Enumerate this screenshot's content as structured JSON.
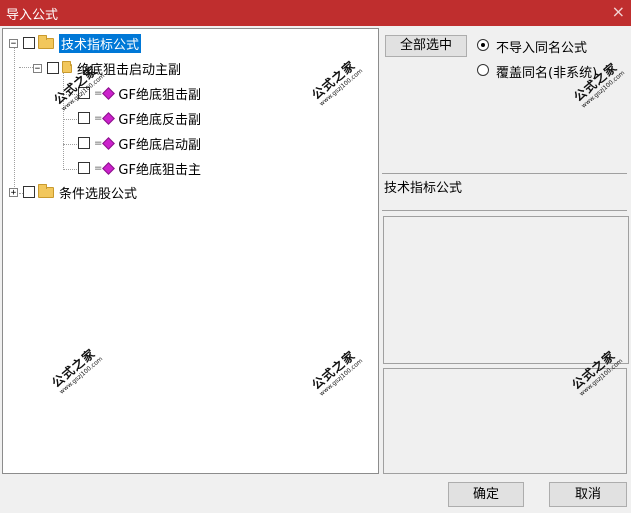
{
  "window": {
    "title": "导入公式",
    "close_icon": "×"
  },
  "tree": {
    "root1": {
      "label": "技术指标公式",
      "expanded": true,
      "selected": true
    },
    "group": {
      "label": "绝底狙击启动主副",
      "expanded": true
    },
    "items": [
      {
        "label": "GF绝底狙击副"
      },
      {
        "label": "GF绝底反击副"
      },
      {
        "label": "GF绝底启动副"
      },
      {
        "label": "GF绝底狙击主"
      }
    ],
    "root2": {
      "label": "条件选股公式",
      "expanded": false
    }
  },
  "options": {
    "select_all_label": "全部选中",
    "radio_no_import": "不导入同名公式",
    "radio_overwrite": "覆盖同名(非系统)",
    "selected": "no_import"
  },
  "info": {
    "category_label": "技术指标公式"
  },
  "footer": {
    "ok_label": "确定",
    "cancel_label": "取消"
  },
  "watermark": {
    "cn": "公式之家",
    "url": "www.gszj100.com"
  },
  "colors": {
    "titlebar": "#bf2e2e",
    "selection": "#0078d7"
  }
}
